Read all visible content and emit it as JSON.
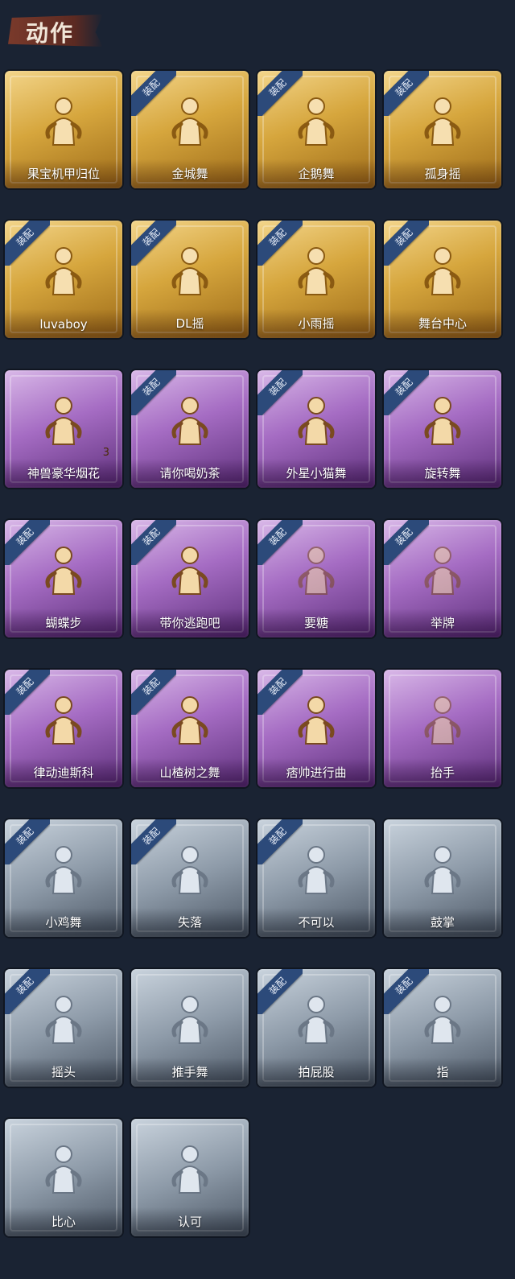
{
  "header": {
    "title": "动作"
  },
  "equip_label": "装配",
  "items": [
    {
      "label": "果宝机甲归位",
      "tier": "gold",
      "equipped": false,
      "icon": "figure-flex-icon"
    },
    {
      "label": "金城舞",
      "tier": "gold",
      "equipped": true,
      "icon": "figure-dance-icon"
    },
    {
      "label": "企鹅舞",
      "tier": "gold",
      "equipped": true,
      "icon": "figure-penguin-icon"
    },
    {
      "label": "孤身摇",
      "tier": "gold",
      "equipped": true,
      "icon": "figure-sway-icon"
    },
    {
      "label": "luvaboy",
      "tier": "gold",
      "equipped": true,
      "icon": "figure-pose-icon"
    },
    {
      "label": "DL摇",
      "tier": "gold",
      "equipped": true,
      "icon": "figure-point-up-icon"
    },
    {
      "label": "小雨摇",
      "tier": "gold",
      "equipped": true,
      "icon": "figure-rain-icon"
    },
    {
      "label": "舞台中心",
      "tier": "gold",
      "equipped": true,
      "icon": "figure-stage-icon"
    },
    {
      "label": "神兽豪华烟花",
      "tier": "purple",
      "equipped": false,
      "icon": "fireworks-icon",
      "count": "3"
    },
    {
      "label": "请你喝奶茶",
      "tier": "purple",
      "equipped": true,
      "icon": "figure-milktea-icon"
    },
    {
      "label": "外星小猫舞",
      "tier": "purple",
      "equipped": true,
      "icon": "figure-cat-icon"
    },
    {
      "label": "旋转舞",
      "tier": "purple",
      "equipped": true,
      "icon": "figure-spin-icon"
    },
    {
      "label": "蝴蝶步",
      "tier": "purple",
      "equipped": true,
      "icon": "figure-butterfly-icon"
    },
    {
      "label": "带你逃跑吧",
      "tier": "purple",
      "equipped": true,
      "icon": "figure-run-icon"
    },
    {
      "label": "要糖",
      "tier": "purple",
      "equipped": true,
      "icon": "figure-candy-icon",
      "dim": true
    },
    {
      "label": "举牌",
      "tier": "purple",
      "equipped": true,
      "icon": "figure-sign-icon",
      "dim": true
    },
    {
      "label": "律动迪斯科",
      "tier": "purple",
      "equipped": true,
      "icon": "figure-disco-icon"
    },
    {
      "label": "山楂树之舞",
      "tier": "purple",
      "equipped": true,
      "icon": "figure-hawthorn-icon"
    },
    {
      "label": "痞帅进行曲",
      "tier": "purple",
      "equipped": true,
      "icon": "figure-march-icon"
    },
    {
      "label": "抬手",
      "tier": "purple",
      "equipped": false,
      "icon": "figure-raise-hand-icon",
      "dim": true
    },
    {
      "label": "小鸡舞",
      "tier": "silver",
      "equipped": true,
      "icon": "figure-chicken-icon"
    },
    {
      "label": "失落",
      "tier": "silver",
      "equipped": true,
      "icon": "figure-kneel-icon"
    },
    {
      "label": "不可以",
      "tier": "silver",
      "equipped": true,
      "icon": "finger-no-icon"
    },
    {
      "label": "鼓掌",
      "tier": "silver",
      "equipped": false,
      "icon": "clap-hands-icon"
    },
    {
      "label": "摇头",
      "tier": "silver",
      "equipped": true,
      "icon": "figure-shake-head-icon"
    },
    {
      "label": "推手舞",
      "tier": "silver",
      "equipped": false,
      "icon": "figure-push-icon"
    },
    {
      "label": "拍屁股",
      "tier": "silver",
      "equipped": true,
      "icon": "figure-pat-icon"
    },
    {
      "label": "指",
      "tier": "silver",
      "equipped": true,
      "icon": "pointing-hand-icon"
    },
    {
      "label": "比心",
      "tier": "silver",
      "equipped": false,
      "icon": "finger-heart-icon"
    },
    {
      "label": "认可",
      "tier": "silver",
      "equipped": false,
      "icon": "thumbs-up-icon"
    }
  ]
}
